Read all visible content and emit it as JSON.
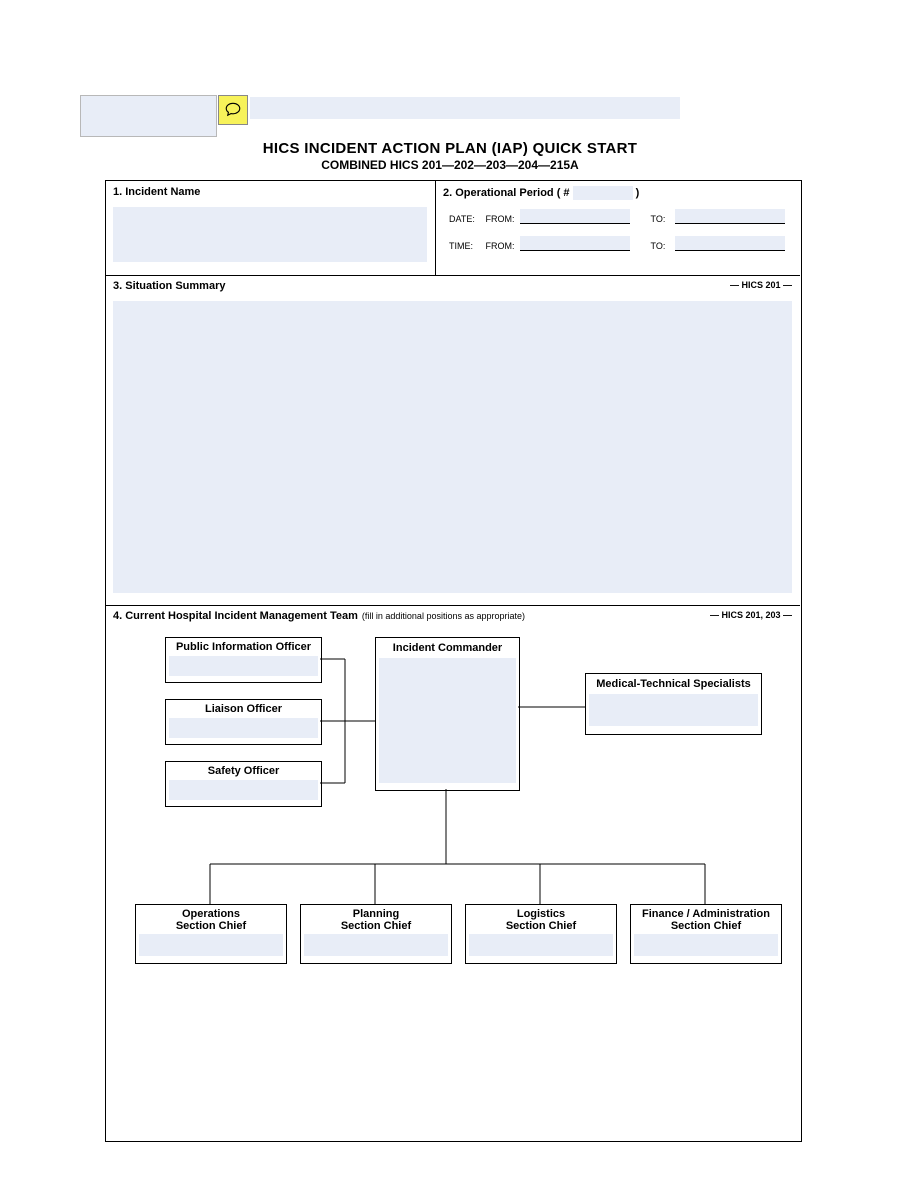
{
  "header": {
    "title": "HICS INCIDENT ACTION PLAN (IAP) QUICK START",
    "subtitle": "COMBINED HICS 201—202—203—204—215A",
    "comment_icon_alt": "comment-icon"
  },
  "sections": {
    "s1": {
      "label": "1.  Incident Name"
    },
    "s2": {
      "label": "2. Operational Period   (  #",
      "label_close": ")",
      "date_label": "DATE:",
      "time_label": "TIME:",
      "from_label": "FROM:",
      "to_label": "TO:"
    },
    "s3": {
      "label": "3.  Situation Summary",
      "ref": "— HICS 201 —"
    },
    "s4": {
      "label": "4.  Current Hospital Incident Management Team",
      "label_note": "(fill in additional positions as appropriate)",
      "ref": "— HICS 201, 203 —"
    }
  },
  "org": {
    "pio": "Public Information Officer",
    "liaison": "Liaison Officer",
    "safety": "Safety Officer",
    "ic": "Incident Commander",
    "medtech": "Medical-Technical Specialists",
    "ops1": "Operations",
    "ops2": "Section Chief",
    "plan1": "Planning",
    "plan2": "Section Chief",
    "log1": "Logistics",
    "log2": "Section Chief",
    "fin1": "Finance / Administration",
    "fin2": "Section Chief"
  }
}
